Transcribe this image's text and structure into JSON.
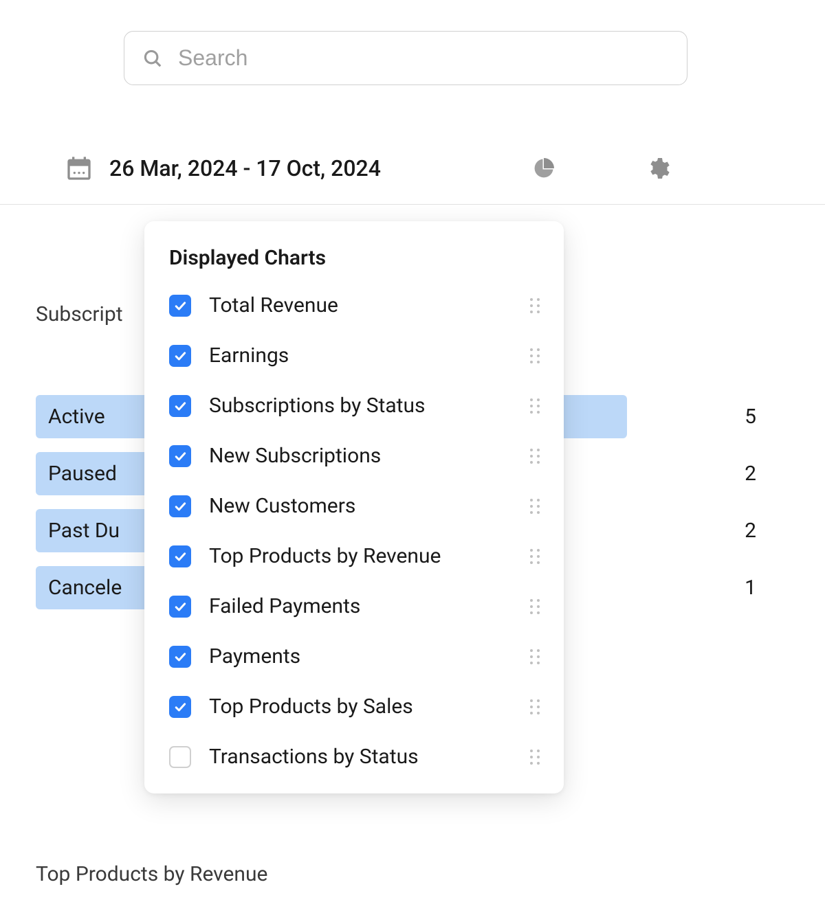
{
  "search": {
    "placeholder": "Search"
  },
  "toolbar": {
    "date_range": "26 Mar, 2024 - 17 Oct, 2024"
  },
  "popover": {
    "title": "Displayed Charts",
    "items": [
      {
        "label": "Total Revenue",
        "checked": true
      },
      {
        "label": "Earnings",
        "checked": true
      },
      {
        "label": "Subscriptions by Status",
        "checked": true
      },
      {
        "label": "New Subscriptions",
        "checked": true
      },
      {
        "label": "New Customers",
        "checked": true
      },
      {
        "label": "Top Products by Revenue",
        "checked": true
      },
      {
        "label": "Failed Payments",
        "checked": true
      },
      {
        "label": "Payments",
        "checked": true
      },
      {
        "label": "Top Products by Sales",
        "checked": true
      },
      {
        "label": "Transactions by Status",
        "checked": false
      }
    ]
  },
  "chart": {
    "title": "Subscript",
    "rows": [
      {
        "label": "Active",
        "value": 5,
        "width_pct": 100
      },
      {
        "label": "Paused",
        "value": 2,
        "width_pct": 40
      },
      {
        "label": "Past Du",
        "value": 2,
        "width_pct": 40
      },
      {
        "label": "Cancele",
        "value": 1,
        "width_pct": 20
      }
    ]
  },
  "bottom_section_title": "Top Products by Revenue",
  "chart_data": {
    "type": "bar",
    "title": "Subscriptions by Status",
    "categories": [
      "Active",
      "Paused",
      "Past Due",
      "Canceled"
    ],
    "values": [
      5,
      2,
      2,
      1
    ],
    "xlabel": "",
    "ylabel": "",
    "ylim": [
      0,
      5
    ]
  }
}
